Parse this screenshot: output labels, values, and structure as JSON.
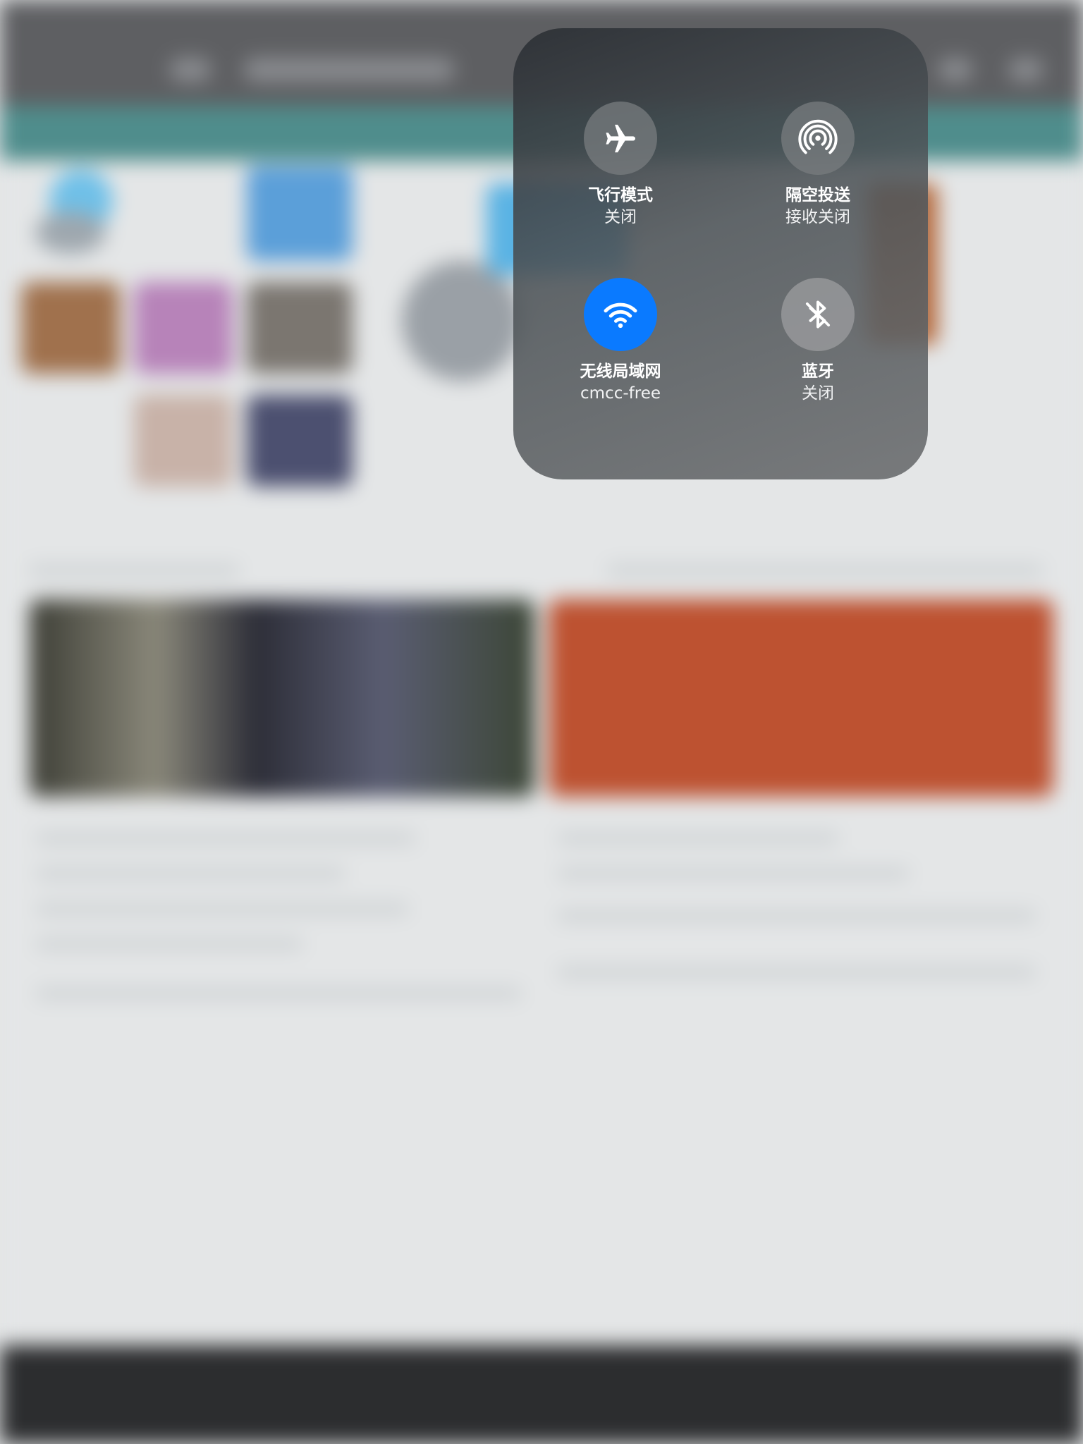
{
  "control_center": {
    "airplane": {
      "title": "飞行模式",
      "status": "关闭",
      "icon": "airplane-icon",
      "active": false
    },
    "airdrop": {
      "title": "隔空投送",
      "status": "接收关闭",
      "icon": "airdrop-icon",
      "active": false
    },
    "wifi": {
      "title": "无线局域网",
      "status": "cmcc-free",
      "icon": "wifi-icon",
      "active": true,
      "color": "#0a7aff"
    },
    "bluetooth": {
      "title": "蓝牙",
      "status": "关闭",
      "icon": "bluetooth-off-icon",
      "active": false
    }
  }
}
